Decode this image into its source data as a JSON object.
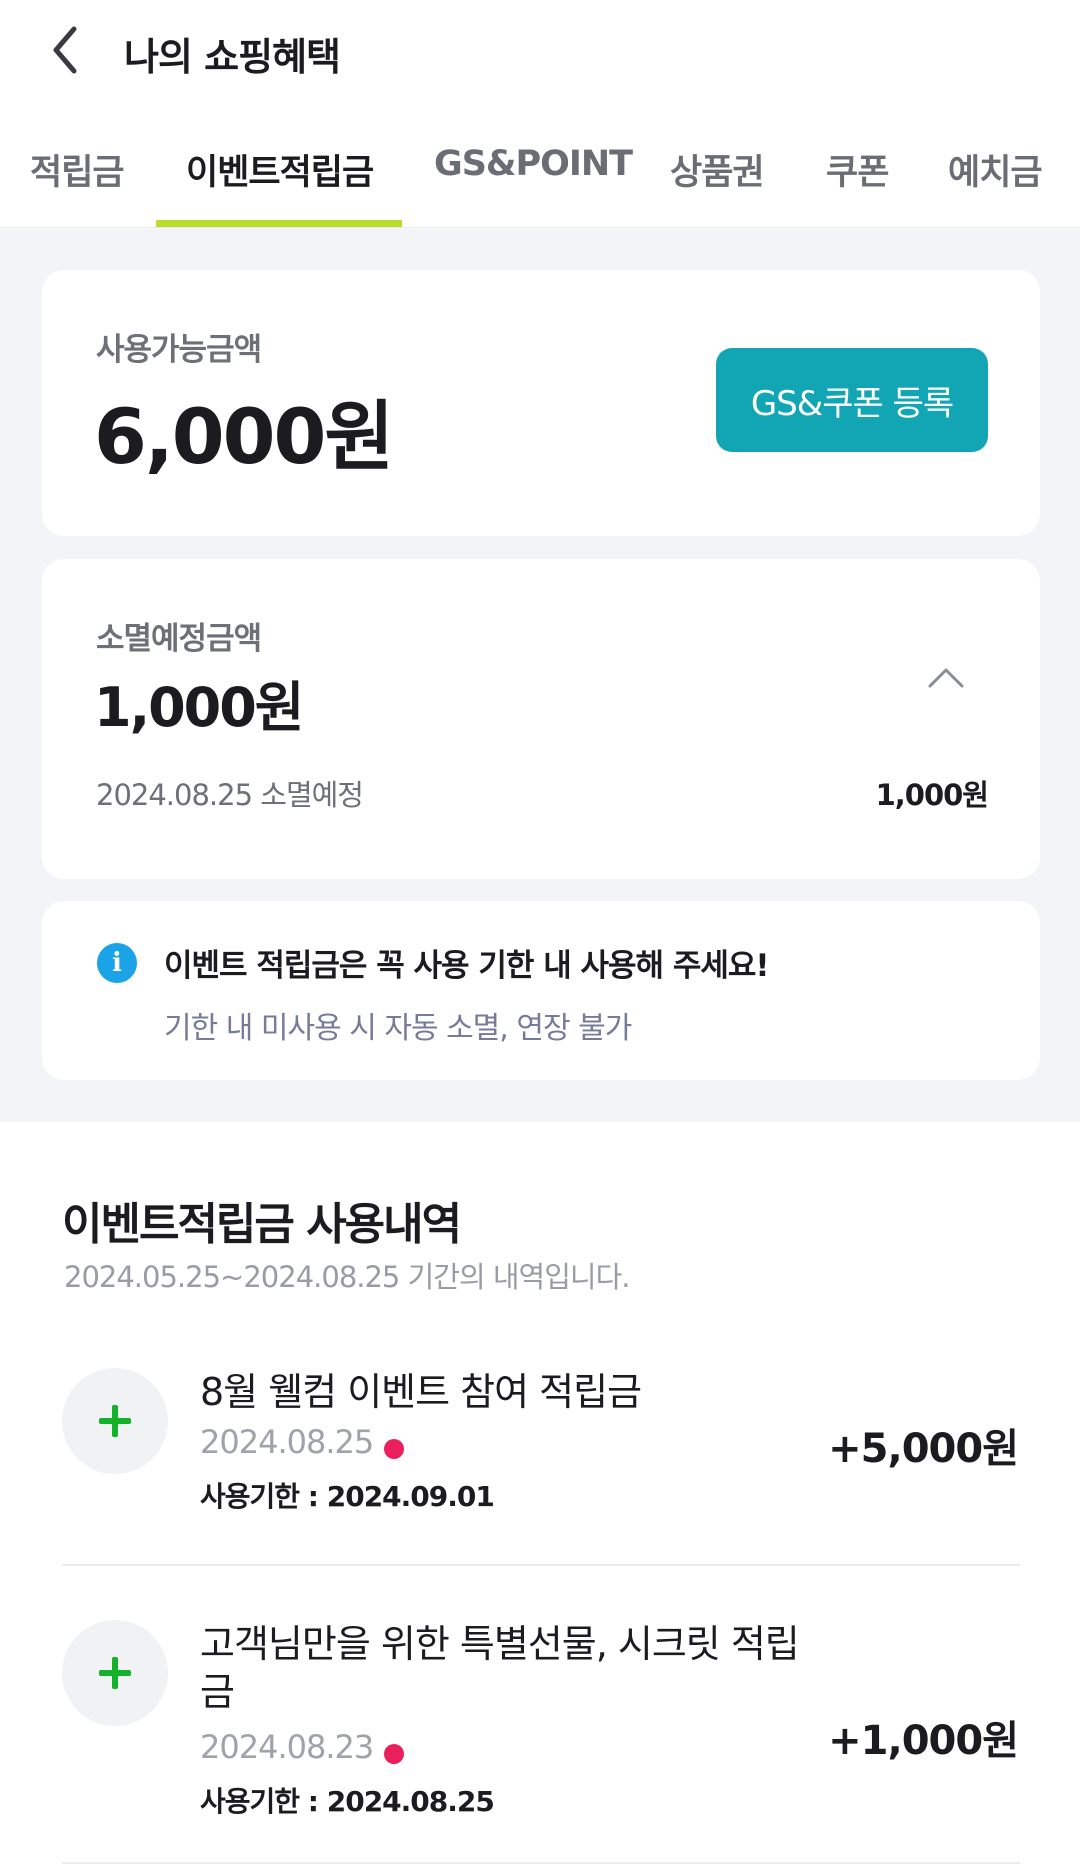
{
  "header": {
    "title": "나의 쇼핑혜택"
  },
  "tabs": [
    {
      "label": "적립금"
    },
    {
      "label": "이벤트적립금"
    },
    {
      "label": "GS&POINT"
    },
    {
      "label": "상품권"
    },
    {
      "label": "쿠폰"
    },
    {
      "label": "예치금"
    }
  ],
  "active_tab": "이벤트적립금",
  "accent_color": "#b9de2a",
  "button_color": "#12a6b4",
  "available": {
    "label": "사용가능금액",
    "amount": "6,000원",
    "register_button": "GS&쿠폰 등록"
  },
  "expiring": {
    "label": "소멸예정금액",
    "amount": "1,000원",
    "items": [
      {
        "date": "2024.08.25 소멸예정",
        "amount": "1,000원"
      }
    ]
  },
  "notice": {
    "title": "이벤트 적립금은 꼭 사용 기한 내 사용해 주세요!",
    "subtitle": "기한 내 미사용 시 자동 소멸, 연장 불가"
  },
  "history": {
    "title": "이벤트적립금 사용내역",
    "period": "2024.05.25~2024.08.25 기간의 내역입니다.",
    "items": [
      {
        "title": "8월 웰컴 이벤트 참여 적립금",
        "date": "2024.08.25",
        "deadline": "사용기한 : 2024.09.01",
        "amount": "+5,000원"
      },
      {
        "title": "고객님만을 위한 특별선물, 시크릿 적립금",
        "date": "2024.08.23",
        "deadline": "사용기한 : 2024.08.25",
        "amount": "+1,000원"
      }
    ]
  }
}
